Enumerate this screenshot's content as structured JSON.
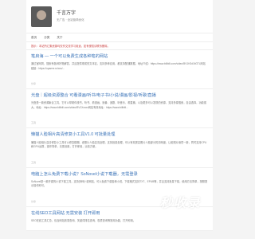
{
  "header": {
    "site_title": "千言万字",
    "site_desc": "无广告 · 全站极简优化"
  },
  "nav": [
    "首页",
    "分类",
    "关于"
  ],
  "notice": "提示：本站所汇集资源均仅作交流学习用途，如有侵权请联系删除。",
  "posts": [
    {
      "title": "笔启海 — 一个可以免费生成各种笔的网站",
      "body": "通过官网简，搜索有各种好笔解答，并且提供现成的文本区，支持多种应用，都支持配通数据。地址介绍：https://www.bilibili.com/video/BV1H2d1fiGTL网站链接：https://oparrer.ru/xxx/...",
      "meta": "分享"
    },
    {
      "title": "光盘｜超级资源整合 可看漫画/听书/电子书/小说/漫画/影视/听歌/直播",
      "body": "光盘是一款资源聚合工具，它可以帮助你找书，听书、看漫画，追番、追剧、听音乐、看直播，以及更多可以发现的资源，支持多源搜索，自由选择，功能强大。地址：https://www.bilibili.com/video/BV1Xxxxx网站有效地址：https://www.bilibili...",
      "meta": "工具"
    },
    {
      "title": "懒猫人脸相片高清修复小工具V1.0 可批量处理",
      "body": "懒猫人脸相片高清修复小工具可以修复模糊、老照片人脸高清处理，支持批量处理，可以有效提高照片人脸部分的清晰度，让老照片焕然一新，同时支持CPU和GPU运算，操作简单，无需设置，打开即用，比较方便。",
      "meta": "工具"
    },
    {
      "title": "电脑上怎么免费下载小说？SoNovel小说下载器，无需登录",
      "body": "SoNovel是一款开源的小说下载工具，支持多种小说网站，可以免费下载各种小说，下载格式支持TXT、EPUB等，并且支持批量下载，使用方法简单，按照提示操作即可。",
      "meta": "分享"
    },
    {
      "title": "在线SEO工具网站 无需安装 打开即用",
      "body": "SEO在线工具汇总，包含网站收录查询、关键词排名查询、权重查询等常用功能，打开即用。",
      "meta": "工具"
    }
  ],
  "watermark": "秒收录"
}
